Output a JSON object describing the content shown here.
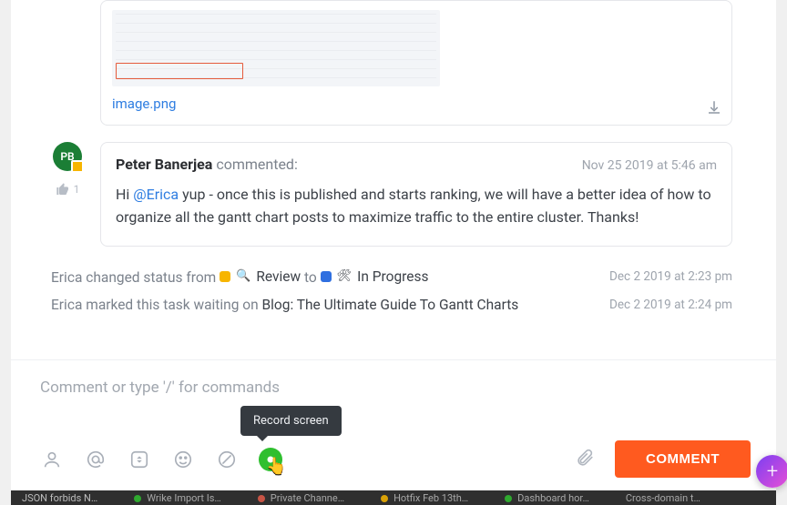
{
  "attachment": {
    "filename": "image.png"
  },
  "comment": {
    "avatar_initials": "PB",
    "author": "Peter Banerjea",
    "verb": "commented:",
    "timestamp": "Nov 25 2019 at 5:46 am",
    "like_count": "1",
    "body_pre": "Hi ",
    "mention": "@Erica",
    "body_post": " yup - once this is published and starts ranking, we will have a better idea of how to organize all the gantt chart posts to maximize traffic to the entire cluster. Thanks!"
  },
  "activity1": {
    "actor": "Erica",
    "pre": " changed status from ",
    "from_label": "Review",
    "mid": " to ",
    "to_label": "In Progress",
    "timestamp": "Dec 2 2019 at 2:23 pm"
  },
  "activity2": {
    "actor": "Erica",
    "pre": " marked this task waiting on ",
    "task": "Blog: The Ultimate Guide To Gantt Charts",
    "timestamp": "Dec 2 2019 at 2:24 pm"
  },
  "composer": {
    "placeholder": "Comment or type '/' for commands",
    "tooltip": "Record screen",
    "button": "COMMENT"
  },
  "dock": {
    "t1": "JSON forbids N…",
    "t2": "Wrike Import Is…",
    "t3": "Private Channe…",
    "t4": "Hotfix Feb 13th…",
    "t5": "Dashboard hor…",
    "t6": "Cross-domain t…"
  }
}
